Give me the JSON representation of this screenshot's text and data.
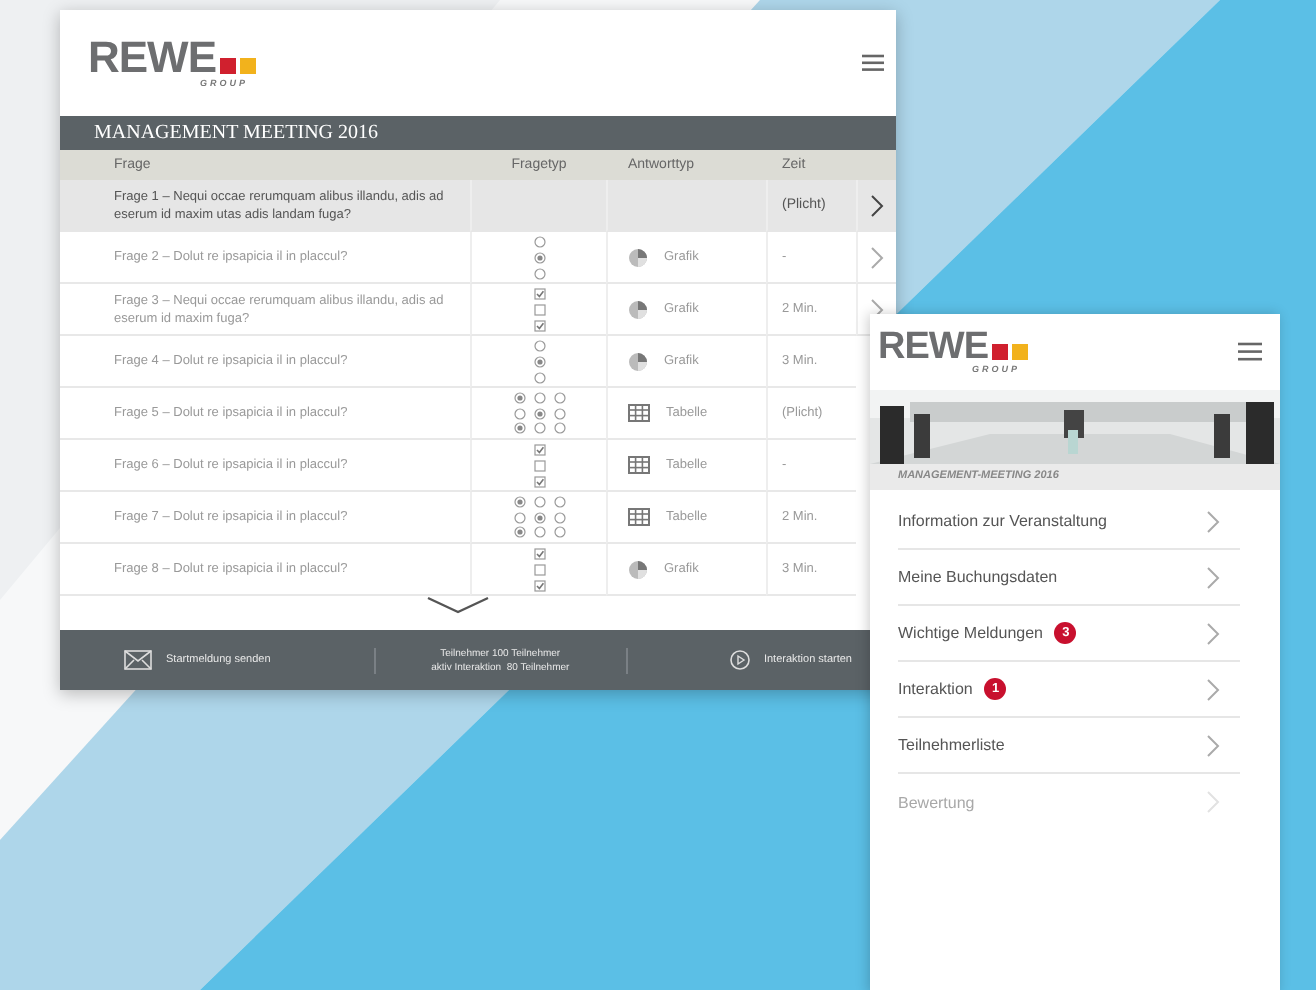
{
  "desktop": {
    "logo": {
      "wordmark": "REWE",
      "sub": "GROUP"
    },
    "title": "MANAGEMENT MEETING 2016",
    "columns": [
      "Frage",
      "Fragetyp",
      "Antworttyp",
      "Zeit"
    ],
    "rows": [
      {
        "frage": "Frage 1 – Nequi occae rerumquam alibus illandu, adis ad eserum id maxim utas adis landam fuga?",
        "zeit": "(Plicht)",
        "selected": true,
        "arrow": true
      },
      {
        "frage": "Frage 2 – Dolut re ipsapicia il in placcul?",
        "fragetyp": {
          "kind": "radio",
          "options": [
            {
              "selected": false
            },
            {
              "selected": true
            },
            {
              "selected": false
            }
          ]
        },
        "antworttyp": {
          "kind": "grafik",
          "label": "Grafik"
        },
        "zeit": "-",
        "selected": false,
        "arrow": true
      },
      {
        "frage": "Frage 3 – Nequi occae rerumquam alibus illandu, adis ad eserum id maxim fuga?",
        "fragetyp": {
          "kind": "checkbox",
          "options": [
            {
              "checked": true
            },
            {
              "checked": false
            },
            {
              "checked": true
            }
          ]
        },
        "antworttyp": {
          "kind": "grafik",
          "label": "Grafik"
        },
        "zeit": "2 Min.",
        "selected": false,
        "arrow": true
      },
      {
        "frage": "Frage 4 – Dolut re ipsapicia il in placcul?",
        "fragetyp": {
          "kind": "radio",
          "options": [
            {
              "selected": false
            },
            {
              "selected": true
            },
            {
              "selected": false
            }
          ]
        },
        "antworttyp": {
          "kind": "grafik",
          "label": "Grafik"
        },
        "zeit": "3 Min.",
        "selected": false,
        "arrow": false
      },
      {
        "frage": "Frage 5 – Dolut re ipsapicia il in placcul?",
        "fragetyp": {
          "kind": "matrix",
          "rows": [
            [
              {
                "selected": true
              },
              {
                "selected": false
              },
              {
                "selected": false
              }
            ],
            [
              {
                "selected": false
              },
              {
                "selected": true
              },
              {
                "selected": false
              }
            ],
            [
              {
                "selected": true
              },
              {
                "selected": false
              },
              {
                "selected": false
              }
            ]
          ]
        },
        "antworttyp": {
          "kind": "tabelle",
          "label": "Tabelle"
        },
        "zeit": "(Plicht)",
        "selected": false,
        "arrow": false
      },
      {
        "frage": "Frage 6 – Dolut re ipsapicia il in placcul?",
        "fragetyp": {
          "kind": "checkbox",
          "options": [
            {
              "checked": true
            },
            {
              "checked": false
            },
            {
              "checked": true
            }
          ]
        },
        "antworttyp": {
          "kind": "tabelle",
          "label": "Tabelle"
        },
        "zeit": "-",
        "selected": false,
        "arrow": false
      },
      {
        "frage": "Frage 7 – Dolut re ipsapicia il in placcul?",
        "fragetyp": {
          "kind": "matrix",
          "rows": [
            [
              {
                "selected": true
              },
              {
                "selected": false
              },
              {
                "selected": false
              }
            ],
            [
              {
                "selected": false
              },
              {
                "selected": true
              },
              {
                "selected": false
              }
            ],
            [
              {
                "selected": true
              },
              {
                "selected": false
              },
              {
                "selected": false
              }
            ]
          ]
        },
        "antworttyp": {
          "kind": "tabelle",
          "label": "Tabelle"
        },
        "zeit": "2 Min.",
        "selected": false,
        "arrow": false
      },
      {
        "frage": "Frage 8 – Dolut re ipsapicia il in placcul?",
        "fragetyp": {
          "kind": "checkbox",
          "options": [
            {
              "checked": true
            },
            {
              "checked": false
            },
            {
              "checked": true
            }
          ]
        },
        "antworttyp": {
          "kind": "grafik",
          "label": "Grafik"
        },
        "zeit": "3 Min.",
        "selected": false,
        "arrow": false
      }
    ],
    "footer": {
      "start": "Startmeldung senden",
      "stats": [
        "Teilnehmer 100 Teilnehmer",
        "aktiv Interaktion  80 Teilnehmer"
      ],
      "interaction": "Interaktion starten"
    }
  },
  "mobile": {
    "logo": {
      "wordmark": "REWE",
      "sub": "GROUP"
    },
    "subtitle": "MANAGEMENT-MEETING 2016",
    "items": [
      {
        "label": "Information zur Veranstaltung",
        "disabled": false
      },
      {
        "label": "Meine Buchungsdaten",
        "disabled": false
      },
      {
        "label": "Wichtige Meldungen",
        "badge": "3",
        "disabled": false
      },
      {
        "label": "Interaktion",
        "badge": "1",
        "disabled": false
      },
      {
        "label": "Teilnehmerliste",
        "disabled": false
      },
      {
        "label": "Bewertung",
        "disabled": true
      }
    ]
  }
}
